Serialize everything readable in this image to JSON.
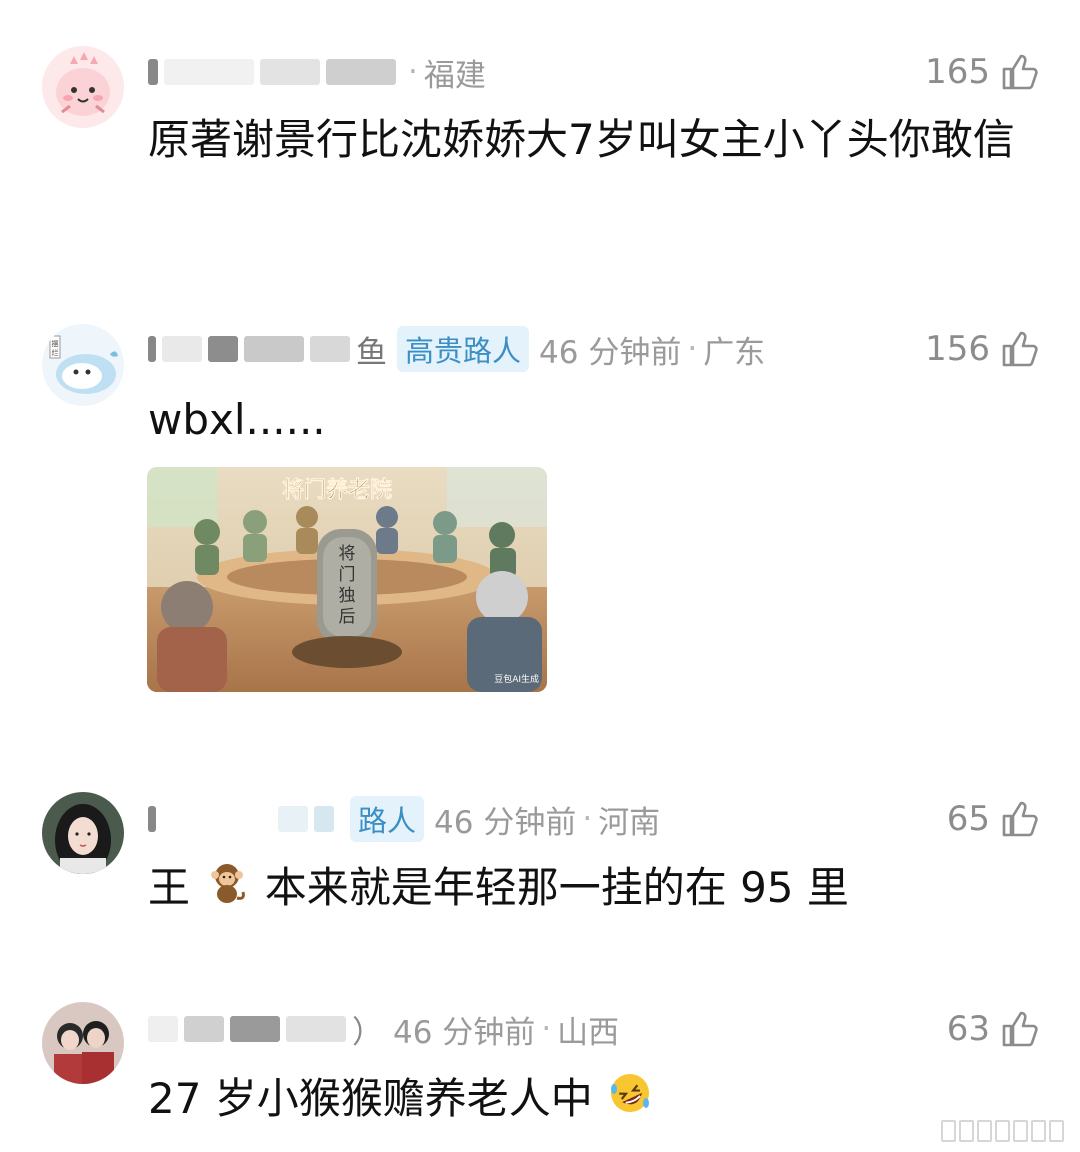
{
  "comments": [
    {
      "name_visible": "",
      "name_tail": "·",
      "badge": "",
      "time": "",
      "location": "福建",
      "likes": "165",
      "text": "原著谢景行比沈娇娇大7岁叫女主小丫头你敢信"
    },
    {
      "name_visible": "鱼",
      "name_tail": "",
      "badge": "高贵路人",
      "time": "46 分钟前",
      "location": "广东",
      "likes": "156",
      "text": "wbxl......",
      "image": {
        "title": "将门养老院",
        "stone_text": "将门独后",
        "watermark": "豆包AI生成"
      }
    },
    {
      "name_visible": "",
      "name_tail": "",
      "badge": "路人",
      "time": "46 分钟前",
      "location": "河南",
      "likes": "65",
      "text_before": "王",
      "emoji": "monkey-emoji",
      "text_after": "本来就是年轻那一挂的在 95 里"
    },
    {
      "name_visible": "）",
      "name_tail": "",
      "badge": "",
      "time": "46 分钟前",
      "location": "山西",
      "likes": "63",
      "text": "27 岁小猴猴赡养老人中",
      "emoji": "rofl-emoji"
    }
  ],
  "colors": {
    "meta": "#9a9a9a",
    "badge_bg": "#e4f2fb",
    "badge_text": "#3b8fc4",
    "text": "#111111"
  }
}
